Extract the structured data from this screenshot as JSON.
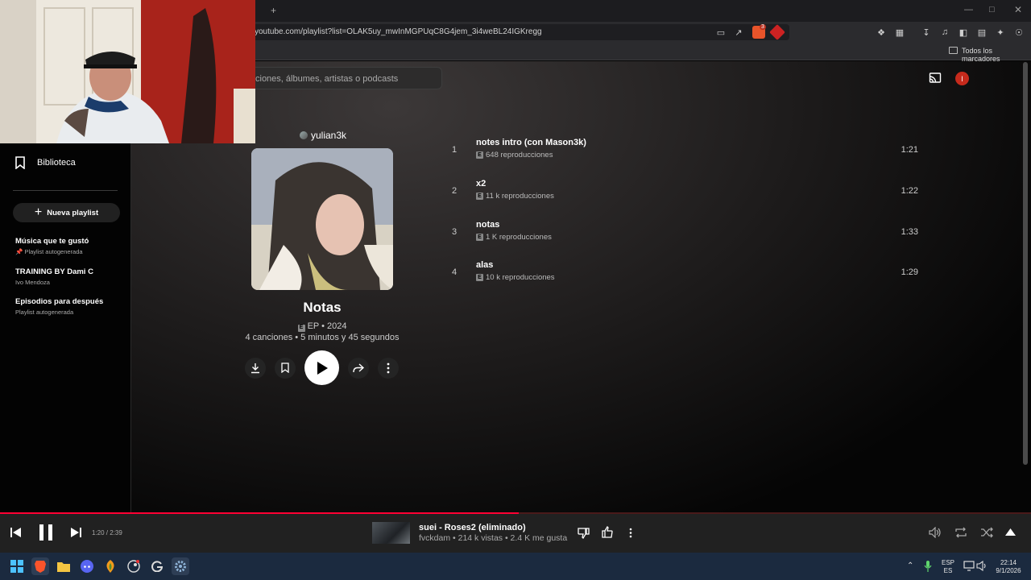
{
  "browser": {
    "url": "youtube.com/playlist?list=OLAK5uy_mwInMGPUqC8G4jem_3i4weBL24IGKregg",
    "bookmarks_label": "Todos los marcadores",
    "new_tab_glyph": "+",
    "shield_count": "3"
  },
  "search": {
    "placeholder": "ciones, álbumes, artistas o podcasts"
  },
  "header": {
    "notification_letter": "I"
  },
  "sidebar": {
    "library_label": "Biblioteca",
    "new_playlist_label": "Nueva playlist",
    "playlists": [
      {
        "title": "Música que te gustó",
        "subtitle": "Playlist autogenerada",
        "pinned": true
      },
      {
        "title": "TRAINING BY Dami C",
        "subtitle": "Ivo Mendoza",
        "pinned": false
      },
      {
        "title": "Episodios para después",
        "subtitle": "Playlist autogenerada",
        "pinned": false
      }
    ]
  },
  "album": {
    "artist": "yulian3k",
    "title": "Notas",
    "type_year": "EP • 2024",
    "summary": "4 canciones • 5 minutos y 45 segundos",
    "explicit_badge": "E"
  },
  "tracks": [
    {
      "number": "1",
      "title": "notes intro (con Mason3k)",
      "plays": "648 reproducciones",
      "duration": "1:21"
    },
    {
      "number": "2",
      "title": "x2",
      "plays": "11 k reproducciones",
      "duration": "1:22"
    },
    {
      "number": "3",
      "title": "notas",
      "plays": "1 K reproducciones",
      "duration": "1:33"
    },
    {
      "number": "4",
      "title": "alas",
      "plays": "10 k reproducciones",
      "duration": "1:29"
    }
  ],
  "player": {
    "time": "1:20 / 2:39",
    "progress_fraction": 0.503,
    "now_playing_title": "suei - Roses2 (eliminado)",
    "now_playing_subtitle": "fvckdam • 214 k vistas • 2.4 K me gusta"
  },
  "taskbar": {
    "lang_top": "ESP",
    "lang_bottom": "ES",
    "time": "22:14",
    "date": "9/1/2026"
  },
  "colors": {
    "accent_red": "#ff0033",
    "player_bg": "#212121",
    "taskbar_bg": "#1b2a3f"
  }
}
